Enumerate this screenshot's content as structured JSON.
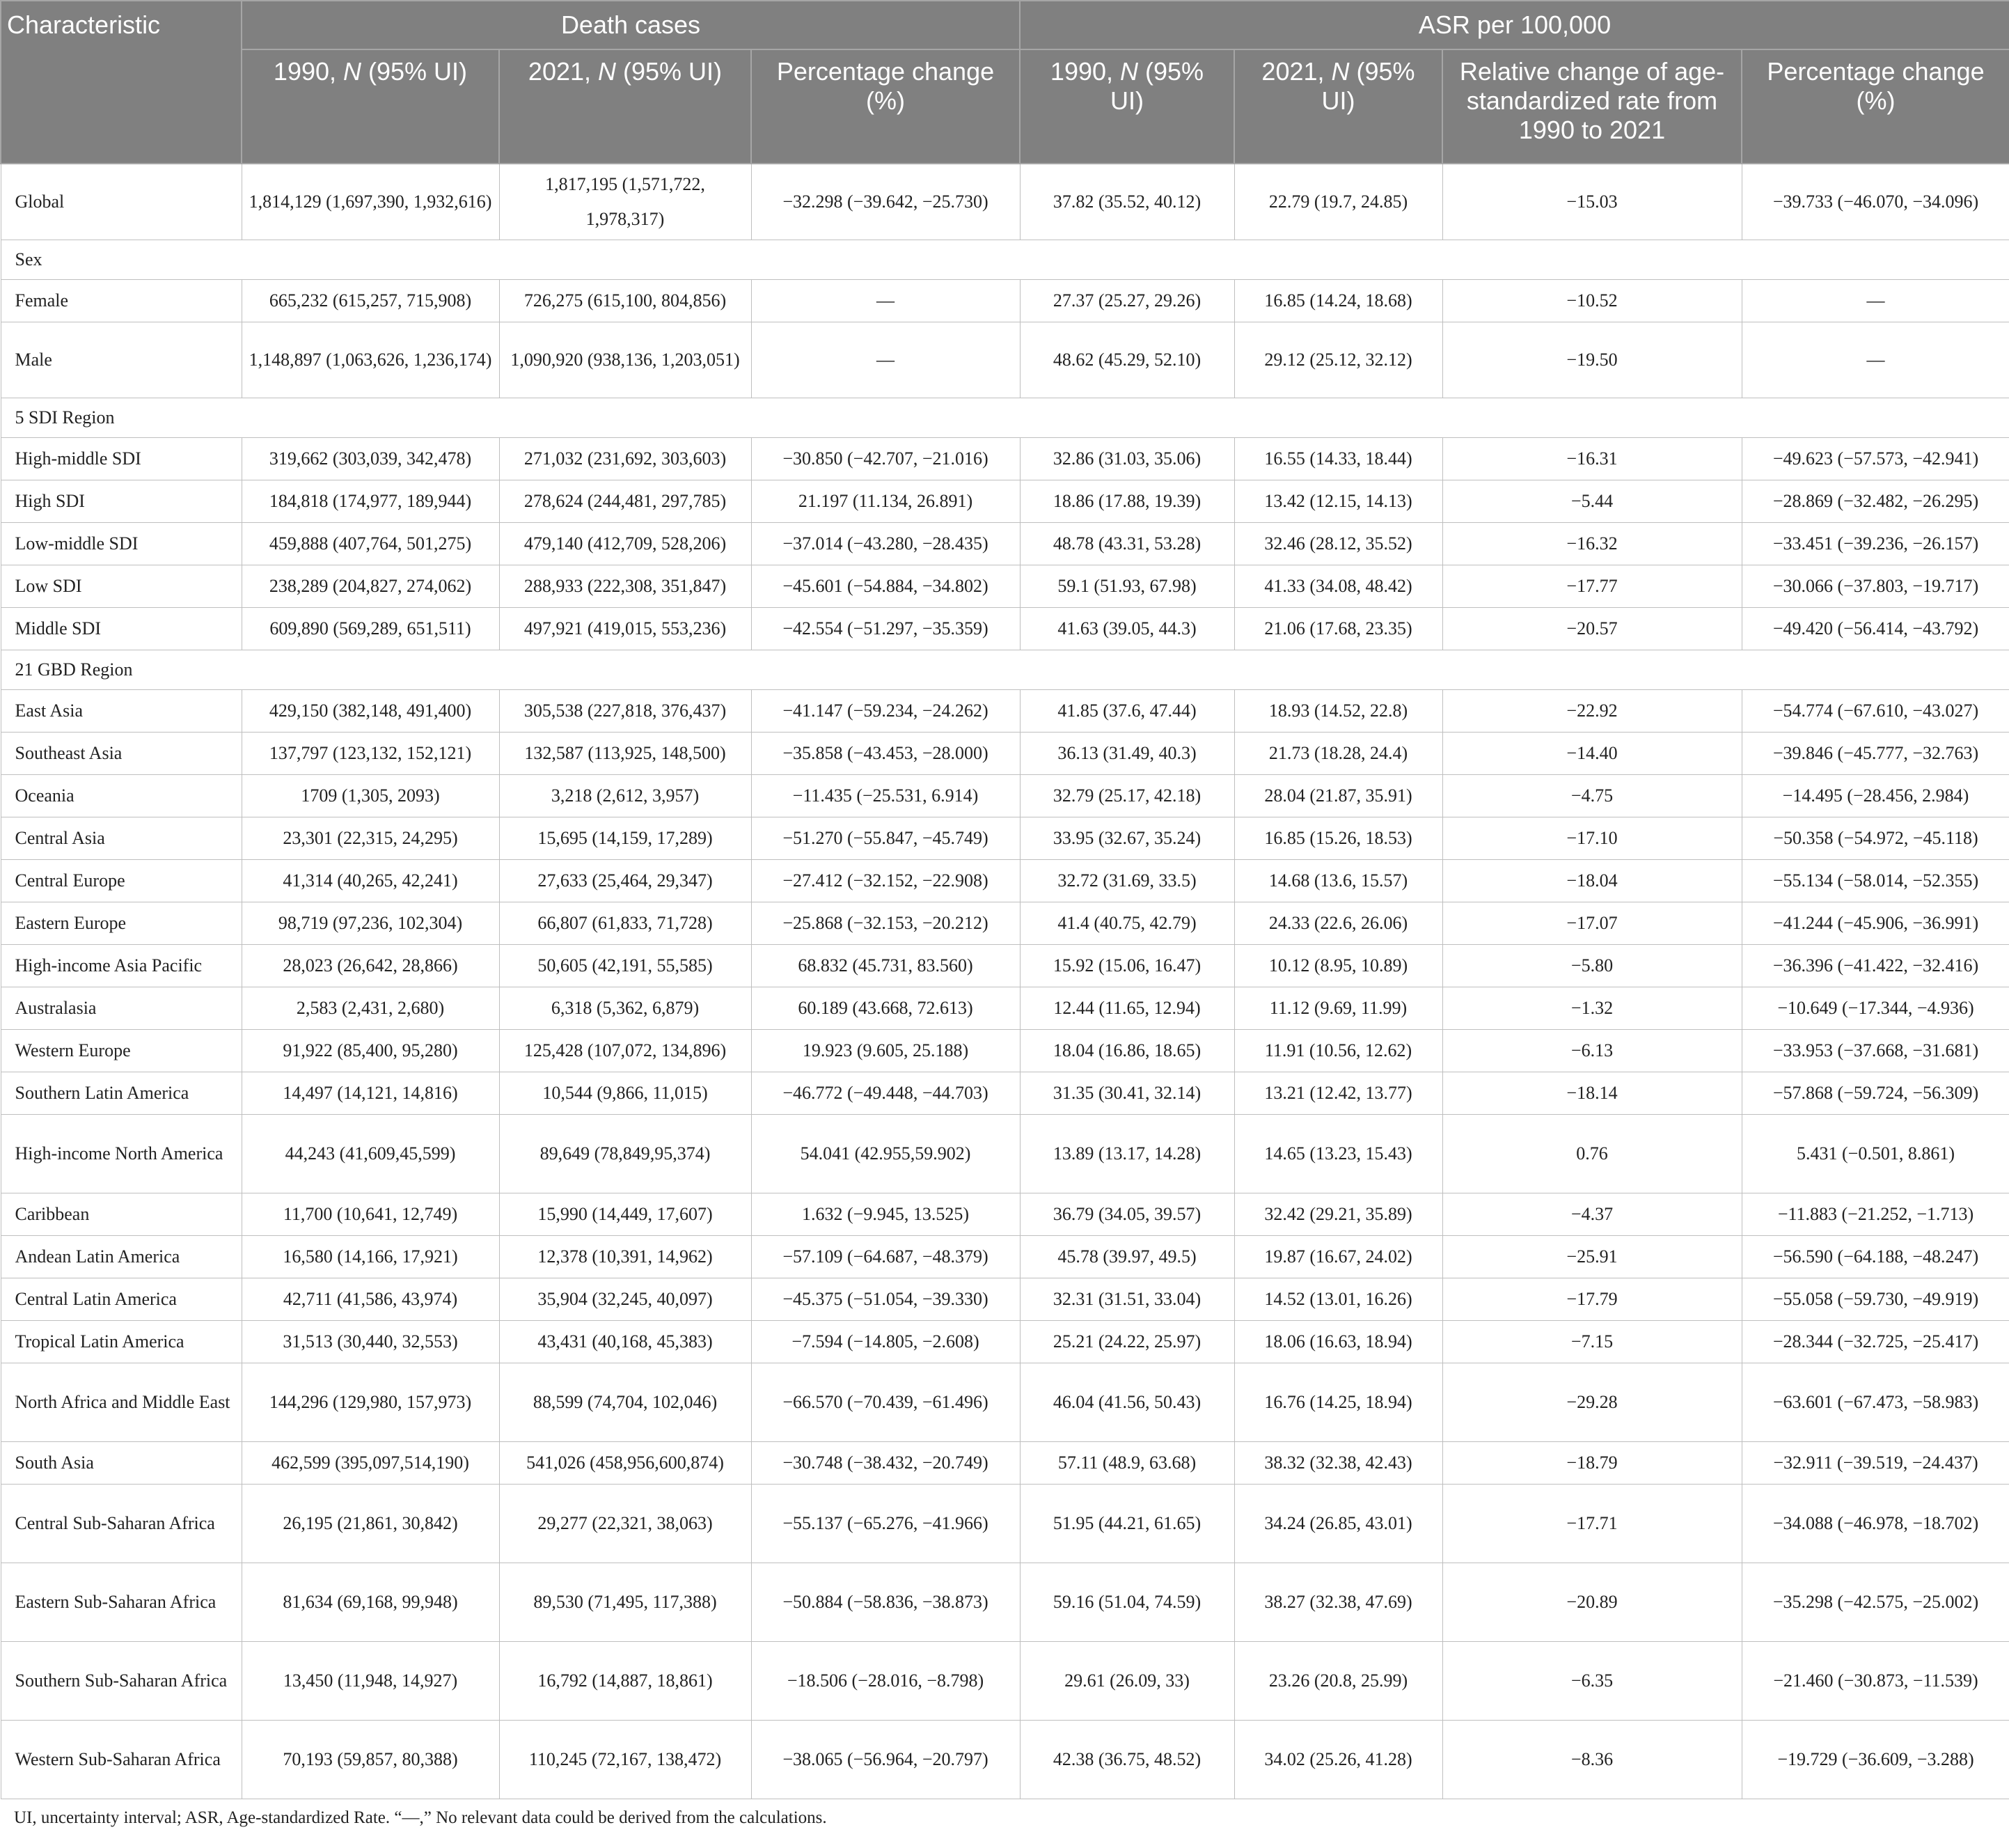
{
  "header": {
    "characteristic": "Characteristic",
    "death_cases": "Death cases",
    "asr": "ASR per 100,000",
    "y1990_prefix": "1990, ",
    "y2021_prefix": "2021, ",
    "n_label": "N",
    "ui_suffix": " (95% UI)",
    "pct_change": "Percentage change (%)",
    "relative_change": "Relative change of age-standardized rate from 1990 to 2021"
  },
  "rows": [
    {
      "type": "data",
      "h": "r2",
      "name": "Global",
      "d1990": "1,814,129 (1,697,390, 1,932,616)",
      "d2021": "1,817,195 (1,571,722, 1,978,317)",
      "dpct": "−32.298 (−39.642, −25.730)",
      "a1990": "37.82 (35.52, 40.12)",
      "a2021": "22.79 (19.7, 24.85)",
      "rel": "−15.03",
      "apct": "−39.733 (−46.070, −34.096)"
    },
    {
      "type": "section",
      "name": "Sex"
    },
    {
      "type": "data",
      "h": "r1",
      "name": "Female",
      "d1990": "665,232 (615,257, 715,908)",
      "d2021": "726,275 (615,100, 804,856)",
      "dpct": "—",
      "a1990": "27.37 (25.27, 29.26)",
      "a2021": "16.85 (14.24, 18.68)",
      "rel": "−10.52",
      "apct": "—"
    },
    {
      "type": "data",
      "h": "r2",
      "name": "Male",
      "d1990": "1,148,897 (1,063,626, 1,236,174)",
      "d2021": "1,090,920 (938,136, 1,203,051)",
      "dpct": "—",
      "a1990": "48.62 (45.29, 52.10)",
      "a2021": "29.12 (25.12, 32.12)",
      "rel": "−19.50",
      "apct": "—"
    },
    {
      "type": "section",
      "name": "5 SDI Region"
    },
    {
      "type": "data",
      "h": "r1",
      "name": "High-middle SDI",
      "d1990": "319,662 (303,039, 342,478)",
      "d2021": "271,032 (231,692, 303,603)",
      "dpct": "−30.850 (−42.707, −21.016)",
      "a1990": "32.86 (31.03, 35.06)",
      "a2021": "16.55 (14.33, 18.44)",
      "rel": "−16.31",
      "apct": "−49.623 (−57.573, −42.941)"
    },
    {
      "type": "data",
      "h": "r1",
      "name": "High SDI",
      "d1990": "184,818 (174,977, 189,944)",
      "d2021": "278,624 (244,481, 297,785)",
      "dpct": "21.197 (11.134, 26.891)",
      "a1990": "18.86 (17.88, 19.39)",
      "a2021": "13.42 (12.15, 14.13)",
      "rel": "−5.44",
      "apct": "−28.869 (−32.482, −26.295)"
    },
    {
      "type": "data",
      "h": "r1",
      "name": "Low-middle SDI",
      "d1990": "459,888 (407,764, 501,275)",
      "d2021": "479,140 (412,709, 528,206)",
      "dpct": "−37.014 (−43.280, −28.435)",
      "a1990": "48.78 (43.31, 53.28)",
      "a2021": "32.46 (28.12, 35.52)",
      "rel": "−16.32",
      "apct": "−33.451 (−39.236, −26.157)"
    },
    {
      "type": "data",
      "h": "r1",
      "name": "Low SDI",
      "d1990": "238,289 (204,827, 274,062)",
      "d2021": "288,933 (222,308, 351,847)",
      "dpct": "−45.601 (−54.884, −34.802)",
      "a1990": "59.1 (51.93, 67.98)",
      "a2021": "41.33 (34.08, 48.42)",
      "rel": "−17.77",
      "apct": "−30.066 (−37.803, −19.717)"
    },
    {
      "type": "data",
      "h": "r1",
      "name": "Middle SDI",
      "d1990": "609,890 (569,289, 651,511)",
      "d2021": "497,921 (419,015, 553,236)",
      "dpct": "−42.554 (−51.297, −35.359)",
      "a1990": "41.63 (39.05, 44.3)",
      "a2021": "21.06 (17.68, 23.35)",
      "rel": "−20.57",
      "apct": "−49.420 (−56.414, −43.792)"
    },
    {
      "type": "section",
      "name": "21 GBD Region"
    },
    {
      "type": "data",
      "h": "r1",
      "name": "East Asia",
      "d1990": "429,150 (382,148, 491,400)",
      "d2021": "305,538 (227,818, 376,437)",
      "dpct": "−41.147 (−59.234, −24.262)",
      "a1990": "41.85 (37.6, 47.44)",
      "a2021": "18.93 (14.52, 22.8)",
      "rel": "−22.92",
      "apct": "−54.774 (−67.610, −43.027)"
    },
    {
      "type": "data",
      "h": "r1",
      "name": "Southeast Asia",
      "d1990": "137,797 (123,132, 152,121)",
      "d2021": "132,587 (113,925, 148,500)",
      "dpct": "−35.858 (−43.453, −28.000)",
      "a1990": "36.13 (31.49, 40.3)",
      "a2021": "21.73 (18.28, 24.4)",
      "rel": "−14.40",
      "apct": "−39.846 (−45.777, −32.763)"
    },
    {
      "type": "data",
      "h": "r1",
      "name": "Oceania",
      "d1990": "1709 (1,305, 2093)",
      "d2021": "3,218 (2,612, 3,957)",
      "dpct": "−11.435 (−25.531, 6.914)",
      "a1990": "32.79 (25.17, 42.18)",
      "a2021": "28.04 (21.87, 35.91)",
      "rel": "−4.75",
      "apct": "−14.495 (−28.456, 2.984)"
    },
    {
      "type": "data",
      "h": "r1",
      "name": "Central Asia",
      "d1990": "23,301 (22,315, 24,295)",
      "d2021": "15,695 (14,159, 17,289)",
      "dpct": "−51.270 (−55.847, −45.749)",
      "a1990": "33.95 (32.67, 35.24)",
      "a2021": "16.85 (15.26, 18.53)",
      "rel": "−17.10",
      "apct": "−50.358 (−54.972, −45.118)"
    },
    {
      "type": "data",
      "h": "r1",
      "name": "Central Europe",
      "d1990": "41,314 (40,265, 42,241)",
      "d2021": "27,633 (25,464, 29,347)",
      "dpct": "−27.412 (−32.152, −22.908)",
      "a1990": "32.72 (31.69, 33.5)",
      "a2021": "14.68 (13.6, 15.57)",
      "rel": "−18.04",
      "apct": "−55.134 (−58.014, −52.355)"
    },
    {
      "type": "data",
      "h": "r1",
      "name": "Eastern Europe",
      "d1990": "98,719 (97,236, 102,304)",
      "d2021": "66,807 (61,833, 71,728)",
      "dpct": "−25.868 (−32.153, −20.212)",
      "a1990": "41.4 (40.75, 42.79)",
      "a2021": "24.33 (22.6, 26.06)",
      "rel": "−17.07",
      "apct": "−41.244 (−45.906, −36.991)"
    },
    {
      "type": "data",
      "h": "r1",
      "name": "High-income Asia Pacific",
      "d1990": "28,023 (26,642, 28,866)",
      "d2021": "50,605 (42,191, 55,585)",
      "dpct": "68.832 (45.731, 83.560)",
      "a1990": "15.92 (15.06, 16.47)",
      "a2021": "10.12 (8.95, 10.89)",
      "rel": "−5.80",
      "apct": "−36.396 (−41.422, −32.416)"
    },
    {
      "type": "data",
      "h": "r1",
      "name": "Australasia",
      "d1990": "2,583 (2,431, 2,680)",
      "d2021": "6,318 (5,362, 6,879)",
      "dpct": "60.189 (43.668, 72.613)",
      "a1990": "12.44 (11.65, 12.94)",
      "a2021": "11.12 (9.69, 11.99)",
      "rel": "−1.32",
      "apct": "−10.649 (−17.344, −4.936)"
    },
    {
      "type": "data",
      "h": "r1",
      "name": "Western Europe",
      "d1990": "91,922 (85,400, 95,280)",
      "d2021": "125,428 (107,072, 134,896)",
      "dpct": "19.923 (9.605, 25.188)",
      "a1990": "18.04 (16.86, 18.65)",
      "a2021": "11.91 (10.56, 12.62)",
      "rel": "−6.13",
      "apct": "−33.953 (−37.668, −31.681)"
    },
    {
      "type": "data",
      "h": "r1",
      "name": "Southern Latin America",
      "d1990": "14,497 (14,121, 14,816)",
      "d2021": "10,544 (9,866, 11,015)",
      "dpct": "−46.772 (−49.448, −44.703)",
      "a1990": "31.35 (30.41, 32.14)",
      "a2021": "13.21 (12.42, 13.77)",
      "rel": "−18.14",
      "apct": "−57.868 (−59.724, −56.309)"
    },
    {
      "type": "data",
      "h": "rg",
      "name": "High-income North America",
      "d1990": "44,243 (41,609,45,599)",
      "d2021": "89,649 (78,849,95,374)",
      "dpct": "54.041 (42.955,59.902)",
      "a1990": "13.89 (13.17, 14.28)",
      "a2021": "14.65 (13.23, 15.43)",
      "rel": "0.76",
      "apct": "5.431 (−0.501, 8.861)"
    },
    {
      "type": "data",
      "h": "r1",
      "name": "Caribbean",
      "d1990": "11,700 (10,641, 12,749)",
      "d2021": "15,990 (14,449, 17,607)",
      "dpct": "1.632 (−9.945, 13.525)",
      "a1990": "36.79 (34.05, 39.57)",
      "a2021": "32.42 (29.21, 35.89)",
      "rel": "−4.37",
      "apct": "−11.883 (−21.252, −1.713)"
    },
    {
      "type": "data",
      "h": "r1",
      "name": "Andean Latin America",
      "d1990": "16,580 (14,166, 17,921)",
      "d2021": "12,378 (10,391, 14,962)",
      "dpct": "−57.109 (−64.687, −48.379)",
      "a1990": "45.78 (39.97, 49.5)",
      "a2021": "19.87 (16.67, 24.02)",
      "rel": "−25.91",
      "apct": "−56.590 (−64.188, −48.247)"
    },
    {
      "type": "data",
      "h": "r1",
      "name": "Central Latin America",
      "d1990": "42,711 (41,586, 43,974)",
      "d2021": "35,904 (32,245, 40,097)",
      "dpct": "−45.375 (−51.054, −39.330)",
      "a1990": "32.31 (31.51, 33.04)",
      "a2021": "14.52 (13.01, 16.26)",
      "rel": "−17.79",
      "apct": "−55.058 (−59.730, −49.919)"
    },
    {
      "type": "data",
      "h": "r1",
      "name": "Tropical Latin America",
      "d1990": "31,513 (30,440, 32,553)",
      "d2021": "43,431 (40,168, 45,383)",
      "dpct": "−7.594 (−14.805, −2.608)",
      "a1990": "25.21 (24.22, 25.97)",
      "a2021": "18.06 (16.63, 18.94)",
      "rel": "−7.15",
      "apct": "−28.344 (−32.725, −25.417)"
    },
    {
      "type": "data",
      "h": "rg",
      "name": "North Africa and Middle East",
      "d1990": "144,296 (129,980, 157,973)",
      "d2021": "88,599 (74,704, 102,046)",
      "dpct": "−66.570 (−70.439, −61.496)",
      "a1990": "46.04 (41.56, 50.43)",
      "a2021": "16.76 (14.25, 18.94)",
      "rel": "−29.28",
      "apct": "−63.601 (−67.473, −58.983)"
    },
    {
      "type": "data",
      "h": "r1",
      "name": "South Asia",
      "d1990": "462,599 (395,097,514,190)",
      "d2021": "541,026 (458,956,600,874)",
      "dpct": "−30.748 (−38.432, −20.749)",
      "a1990": "57.11 (48.9, 63.68)",
      "a2021": "38.32 (32.38, 42.43)",
      "rel": "−18.79",
      "apct": "−32.911 (−39.519, −24.437)"
    },
    {
      "type": "data",
      "h": "rg",
      "name": "Central Sub-Saharan Africa",
      "d1990": "26,195 (21,861, 30,842)",
      "d2021": "29,277 (22,321, 38,063)",
      "dpct": "−55.137 (−65.276, −41.966)",
      "a1990": "51.95 (44.21, 61.65)",
      "a2021": "34.24 (26.85, 43.01)",
      "rel": "−17.71",
      "apct": "−34.088 (−46.978, −18.702)"
    },
    {
      "type": "data",
      "h": "rg",
      "name": "Eastern Sub-Saharan Africa",
      "d1990": "81,634 (69,168, 99,948)",
      "d2021": "89,530 (71,495, 117,388)",
      "dpct": "−50.884 (−58.836, −38.873)",
      "a1990": "59.16 (51.04, 74.59)",
      "a2021": "38.27 (32.38, 47.69)",
      "rel": "−20.89",
      "apct": "−35.298 (−42.575, −25.002)"
    },
    {
      "type": "data",
      "h": "rg",
      "name": "Southern Sub-Saharan Africa",
      "d1990": "13,450 (11,948, 14,927)",
      "d2021": "16,792 (14,887, 18,861)",
      "dpct": "−18.506 (−28.016, −8.798)",
      "a1990": "29.61 (26.09, 33)",
      "a2021": "23.26 (20.8, 25.99)",
      "rel": "−6.35",
      "apct": "−21.460 (−30.873, −11.539)"
    },
    {
      "type": "data",
      "h": "rg",
      "name": "Western Sub-Saharan Africa",
      "d1990": "70,193 (59,857, 80,388)",
      "d2021": "110,245 (72,167, 138,472)",
      "dpct": "−38.065 (−56.964, −20.797)",
      "a1990": "42.38 (36.75, 48.52)",
      "a2021": "34.02 (25.26, 41.28)",
      "rel": "−8.36",
      "apct": "−19.729 (−36.609, −3.288)"
    }
  ],
  "footnote": "UI, uncertainty interval; ASR, Age-standardized Rate. “—,” No relevant data could be derived from the calculations."
}
